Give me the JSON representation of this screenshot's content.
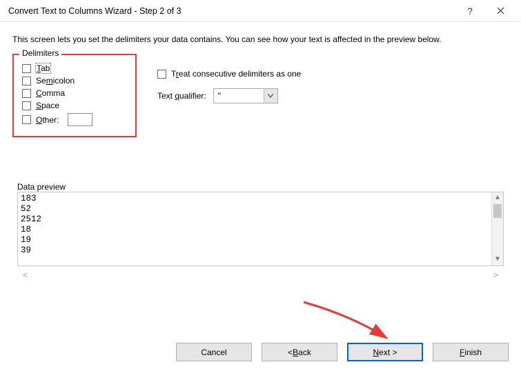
{
  "window": {
    "title": "Convert Text to Columns Wizard - Step 2 of 3"
  },
  "desc": "This screen lets you set the delimiters your data contains.  You can see how your text is affected in the preview below.",
  "delimiters": {
    "legend": "Delimiters",
    "tab": "Tab",
    "semicolon": "Semicolon",
    "comma": "Comma",
    "space": "Space",
    "other": "Other:"
  },
  "consecutive_label": "Treat consecutive delimiters as one",
  "qualifier": {
    "label": "Text qualifier:",
    "value": "\""
  },
  "preview": {
    "legend": "Data preview",
    "lines": [
      "183",
      "52",
      "2512",
      "18",
      "19",
      "39"
    ]
  },
  "buttons": {
    "cancel": "Cancel",
    "back": "< Back",
    "next": "Next >",
    "finish": "Finish"
  }
}
